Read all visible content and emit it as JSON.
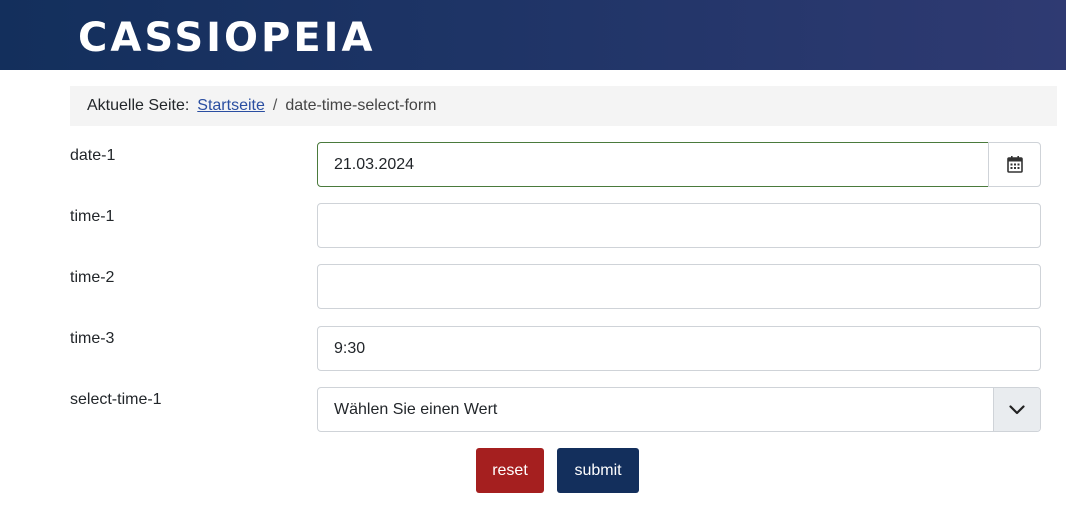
{
  "header": {
    "brand": "CASSIOPEIA"
  },
  "breadcrumb": {
    "prefix": "Aktuelle Seite:",
    "home_link": "Startseite",
    "separator": "/",
    "current": "date-time-select-form"
  },
  "form": {
    "date1": {
      "label": "date-1",
      "value": "21.03.2024"
    },
    "time1": {
      "label": "time-1",
      "value": ""
    },
    "time2": {
      "label": "time-2",
      "value": ""
    },
    "time3": {
      "label": "time-3",
      "value": "9:30"
    },
    "select_time1": {
      "label": "select-time-1",
      "selected": "Wählen Sie einen Wert"
    }
  },
  "buttons": {
    "reset": "reset",
    "submit": "submit"
  },
  "icons": {
    "calendar": "calendar-icon",
    "chevron": "chevron-down-icon"
  },
  "colors": {
    "header": "#132f5c",
    "reset": "#a51f1f",
    "submit": "#132f5c",
    "link": "#2a4ea1"
  }
}
